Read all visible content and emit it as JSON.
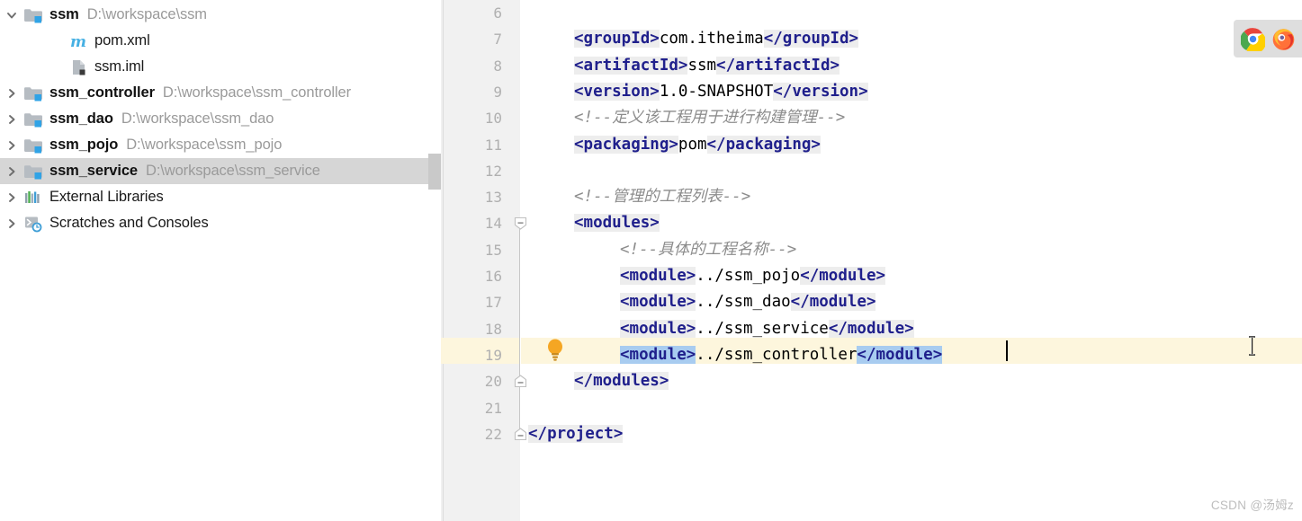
{
  "sidebar": {
    "name": "project-tree",
    "items": [
      {
        "arrow": "chevron-down",
        "icon": "module-folder-icon",
        "label": "ssm",
        "path": "D:\\workspace\\ssm",
        "indent": 0,
        "selected": false,
        "bold": true
      },
      {
        "arrow": "none",
        "icon": "maven-pom-icon",
        "label": "pom.xml",
        "path": "",
        "indent": 1,
        "selected": false,
        "bold": false
      },
      {
        "arrow": "none",
        "icon": "iml-file-icon",
        "label": "ssm.iml",
        "path": "",
        "indent": 1,
        "selected": false,
        "bold": false
      },
      {
        "arrow": "chevron-right",
        "icon": "module-folder-icon",
        "label": "ssm_controller",
        "path": "D:\\workspace\\ssm_controller",
        "indent": 0,
        "selected": false,
        "bold": true
      },
      {
        "arrow": "chevron-right",
        "icon": "module-folder-icon",
        "label": "ssm_dao",
        "path": "D:\\workspace\\ssm_dao",
        "indent": 0,
        "selected": false,
        "bold": true
      },
      {
        "arrow": "chevron-right",
        "icon": "module-folder-icon",
        "label": "ssm_pojo",
        "path": "D:\\workspace\\ssm_pojo",
        "indent": 0,
        "selected": false,
        "bold": true
      },
      {
        "arrow": "chevron-right",
        "icon": "module-folder-icon",
        "label": "ssm_service",
        "path": "D:\\workspace\\ssm_service",
        "indent": 0,
        "selected": true,
        "bold": true
      },
      {
        "arrow": "chevron-right",
        "icon": "external-libraries-icon",
        "label": "External Libraries",
        "path": "",
        "indent": 0,
        "selected": false,
        "bold": false
      },
      {
        "arrow": "chevron-right",
        "icon": "scratches-consoles-icon",
        "label": "Scratches and Consoles",
        "path": "",
        "indent": 0,
        "selected": false,
        "bold": false
      }
    ]
  },
  "editor": {
    "name": "pom-xml-editor",
    "current_line": 19,
    "first_visible_line": 6,
    "last_visible_line": 22,
    "fold_marker_lines": [
      14,
      20,
      22
    ],
    "lines": [
      {
        "number": 6,
        "indent": 0,
        "segments": []
      },
      {
        "number": 7,
        "indent": 1,
        "segments": [
          {
            "type": "tag",
            "text": "<groupId>"
          },
          {
            "type": "val",
            "text": "com.itheima"
          },
          {
            "type": "tag",
            "text": "</groupId>"
          }
        ]
      },
      {
        "number": 8,
        "indent": 1,
        "segments": [
          {
            "type": "tag",
            "text": "<artifactId>"
          },
          {
            "type": "val",
            "text": "ssm"
          },
          {
            "type": "tag",
            "text": "</artifactId>"
          }
        ]
      },
      {
        "number": 9,
        "indent": 1,
        "segments": [
          {
            "type": "tag",
            "text": "<version>"
          },
          {
            "type": "val",
            "text": "1.0-SNAPSHOT"
          },
          {
            "type": "tag",
            "text": "</version>"
          }
        ]
      },
      {
        "number": 10,
        "indent": 1,
        "segments": [
          {
            "type": "comment",
            "text": "<!--定义该工程用于进行构建管理-->"
          }
        ]
      },
      {
        "number": 11,
        "indent": 1,
        "segments": [
          {
            "type": "tag",
            "text": "<packaging>"
          },
          {
            "type": "val",
            "text": "pom"
          },
          {
            "type": "tag",
            "text": "</packaging>"
          }
        ]
      },
      {
        "number": 12,
        "indent": 0,
        "segments": []
      },
      {
        "number": 13,
        "indent": 1,
        "segments": [
          {
            "type": "comment",
            "text": "<!--管理的工程列表-->"
          }
        ]
      },
      {
        "number": 14,
        "indent": 1,
        "segments": [
          {
            "type": "tag",
            "text": "<modules>"
          }
        ]
      },
      {
        "number": 15,
        "indent": 2,
        "segments": [
          {
            "type": "comment",
            "text": "<!--具体的工程名称-->"
          }
        ]
      },
      {
        "number": 16,
        "indent": 2,
        "segments": [
          {
            "type": "tag",
            "text": "<module>"
          },
          {
            "type": "val",
            "text": "../ssm_pojo"
          },
          {
            "type": "tag",
            "text": "</module>"
          }
        ]
      },
      {
        "number": 17,
        "indent": 2,
        "segments": [
          {
            "type": "tag",
            "text": "<module>"
          },
          {
            "type": "val",
            "text": "../ssm_dao"
          },
          {
            "type": "tag",
            "text": "</module>"
          }
        ]
      },
      {
        "number": 18,
        "indent": 2,
        "segments": [
          {
            "type": "tag",
            "text": "<module>"
          },
          {
            "type": "val",
            "text": "../ssm_service"
          },
          {
            "type": "tag",
            "text": "</module>"
          }
        ]
      },
      {
        "number": 19,
        "indent": 2,
        "segments": [
          {
            "type": "tag-selected",
            "text": "<module>"
          },
          {
            "type": "val",
            "text": "../ssm_controller"
          },
          {
            "type": "tag-selected",
            "text": "</module>"
          }
        ]
      },
      {
        "number": 20,
        "indent": 1,
        "segments": [
          {
            "type": "tag",
            "text": "</modules>"
          }
        ]
      },
      {
        "number": 21,
        "indent": 0,
        "segments": []
      },
      {
        "number": 22,
        "indent": 0,
        "segments": [
          {
            "type": "tag",
            "text": "</project>"
          }
        ]
      }
    ]
  },
  "browser_panel": {
    "name": "browser-launch-panel",
    "icons": [
      {
        "name": "chrome-icon",
        "title": "Chrome"
      },
      {
        "name": "firefox-icon",
        "title": "Firefox"
      }
    ]
  },
  "watermark": {
    "text": "CSDN @汤姆z"
  },
  "colors": {
    "tag": "#20208c",
    "comment": "#8c8c8c",
    "selection": "#a8ccf0",
    "current_line": "#fdf6dd",
    "tree_selected": "#d6d6d6",
    "gutter": "#f1f1f1",
    "line_number": "#b0b0b0",
    "path_text": "#9a9a9a"
  }
}
